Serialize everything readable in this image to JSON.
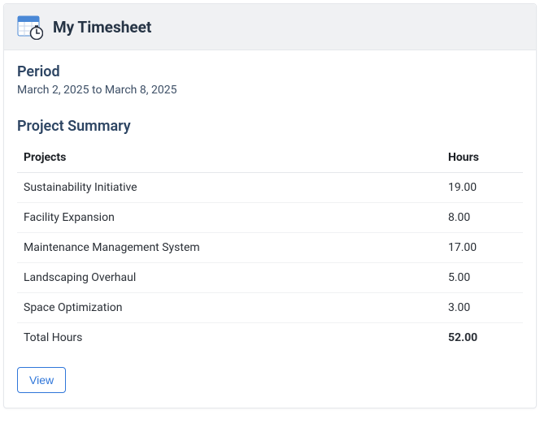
{
  "header": {
    "title": "My Timesheet"
  },
  "period": {
    "label": "Period",
    "text": "March 2, 2025 to March 8, 2025"
  },
  "summary": {
    "title": "Project Summary",
    "columns": {
      "projects": "Projects",
      "hours": "Hours"
    },
    "rows": [
      {
        "project": "Sustainability Initiative",
        "hours": "19.00"
      },
      {
        "project": "Facility Expansion",
        "hours": "8.00"
      },
      {
        "project": "Maintenance Management System",
        "hours": "17.00"
      },
      {
        "project": "Landscaping Overhaul",
        "hours": "5.00"
      },
      {
        "project": "Space Optimization",
        "hours": "3.00"
      }
    ],
    "total": {
      "label": "Total Hours",
      "hours": "52.00"
    }
  },
  "actions": {
    "view_label": "View"
  }
}
